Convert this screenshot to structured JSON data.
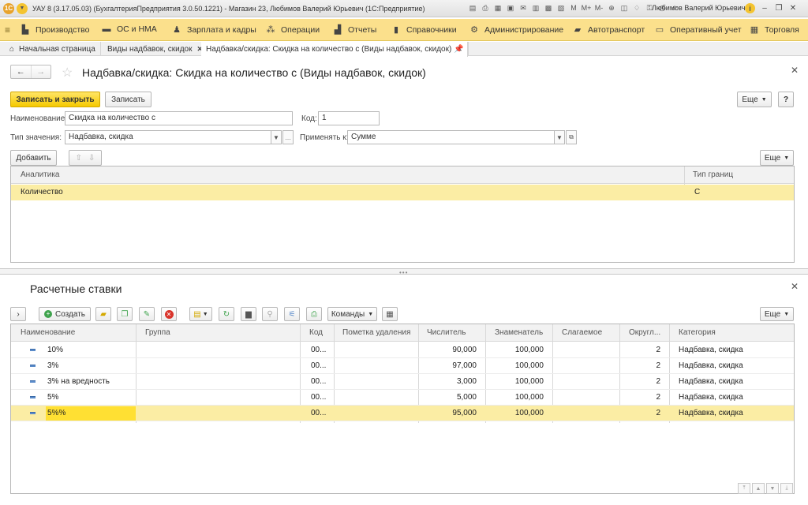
{
  "titlebar": {
    "text": "УАУ 8 (3.17.05.03) (БухгалтерияПредприятия 3.0.50.1221) - Магазин 23, Любимов Валерий Юрьевич  (1С:Предприятие)",
    "user": "Любимов Валерий Юрьевич",
    "m": "M",
    "mplus": "M+",
    "mminus": "M-"
  },
  "menu": [
    {
      "label": "Производство"
    },
    {
      "label": "ОС и НМА"
    },
    {
      "label": "Зарплата и кадры"
    },
    {
      "label": "Операции"
    },
    {
      "label": "Отчеты"
    },
    {
      "label": "Справочники"
    },
    {
      "label": "Администрирование"
    },
    {
      "label": "Автотранспорт"
    },
    {
      "label": "Оперативный учет"
    },
    {
      "label": "Торговля"
    }
  ],
  "tabs": [
    {
      "label": "Начальная страница"
    },
    {
      "label": "Виды надбавок, скидок"
    },
    {
      "label": "Надбавка/скидка: Скидка на количество с (Виды надбавок, скидок)"
    }
  ],
  "form": {
    "title": "Надбавка/скидка: Скидка на количество с (Виды надбавок, скидок)",
    "save_close": "Записать и закрыть",
    "save": "Записать",
    "more": "Еще",
    "help": "?",
    "name_label": "Наименование:",
    "name_value": "Скидка на количество с",
    "code_label": "Код:",
    "code_value": "1",
    "type_label": "Тип значения:",
    "type_value": "Надбавка, скидка",
    "apply_label": "Применять к:",
    "apply_value": "Сумме",
    "add": "Добавить",
    "more2": "Еще"
  },
  "analytics": {
    "headers": [
      "Аналитика",
      "Тип границ"
    ],
    "rows": [
      [
        "Количество",
        "С"
      ]
    ]
  },
  "rates": {
    "title": "Расчетные ставки",
    "create": "Создать",
    "commands": "Команды",
    "more": "Еще",
    "headers": [
      "Наименование",
      "Группа",
      "Код",
      "Пометка удаления",
      "Числитель",
      "Знаменатель",
      "Слагаемое",
      "Округл...",
      "Категория"
    ],
    "rows": [
      {
        "name": "10%",
        "code": "00...",
        "num": "90,000",
        "den": "100,000",
        "round": "2",
        "cat": "Надбавка, скидка"
      },
      {
        "name": "3%",
        "code": "00...",
        "num": "97,000",
        "den": "100,000",
        "round": "2",
        "cat": "Надбавка, скидка"
      },
      {
        "name": "3% на вредность",
        "code": "00...",
        "num": "3,000",
        "den": "100,000",
        "round": "2",
        "cat": "Надбавка, скидка"
      },
      {
        "name": "5%",
        "code": "00...",
        "num": "5,000",
        "den": "100,000",
        "round": "2",
        "cat": "Надбавка, скидка"
      },
      {
        "name": "5%%",
        "code": "00...",
        "num": "95,000",
        "den": "100,000",
        "round": "2",
        "cat": "Надбавка, скидка"
      }
    ]
  }
}
